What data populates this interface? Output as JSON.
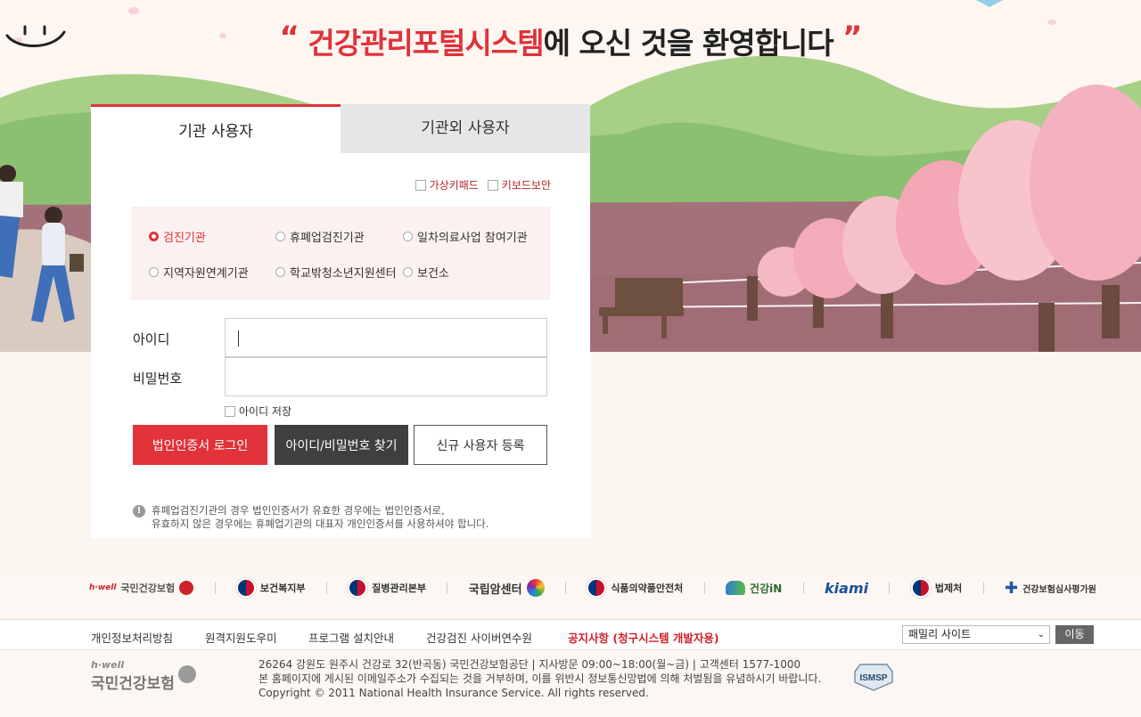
{
  "welcome": {
    "open_quote": "“",
    "highlight": "건강관리포털시스템",
    "rest": "에 오신 것을 환영합니다",
    "close_quote": "”"
  },
  "tabs": [
    {
      "label": "기관 사용자",
      "active": true
    },
    {
      "label": "기관외 사용자",
      "active": false
    }
  ],
  "security": {
    "virtual_keypad": "가상키패드",
    "keyboard_security": "키보드보안"
  },
  "org_types": [
    {
      "label": "검진기관",
      "selected": true
    },
    {
      "label": "휴폐업검진기관",
      "selected": false
    },
    {
      "label": "일차의료사업 참여기관",
      "selected": false
    },
    {
      "label": "지역자원연계기관",
      "selected": false
    },
    {
      "label": "학교밖청소년지원센터",
      "selected": false
    },
    {
      "label": "보건소",
      "selected": false
    }
  ],
  "form": {
    "id_label": "아이디",
    "pw_label": "비밀번호",
    "save_id": "아이디 저장"
  },
  "buttons": {
    "cert_login": "법인인증서 로그인",
    "find_id_pw": "아이디/비밀번호 찾기",
    "register": "신규 사용자 등록"
  },
  "notice": {
    "line1": "휴폐업검진기관의 경우 법인인증서가 유효한 경우에는 법인인증서로,",
    "line2": "유효하지 않은 경우에는 휴폐업기관의 대표자 개인인증서를 사용하셔야 합니다."
  },
  "partners": {
    "nhis": "국민건강보험",
    "mohw": "보건복지부",
    "kdca": "질병관리본부",
    "ncc": "국립암센터",
    "mfds": "식품의약품안전처",
    "health_in": "건강iN",
    "kiami": "kiami",
    "moleg": "법제처",
    "hira": "건강보험심사평가원"
  },
  "footer_nav": {
    "privacy": "개인정보처리방침",
    "remote": "원격지원도우미",
    "install": "프로그램 설치안내",
    "cyber": "건강검진 사이버연수원",
    "notice": "공지사항 (청구시스템 개발자용)",
    "family_site": "패밀리 사이트",
    "go": "이동"
  },
  "footer": {
    "logo_small": "h·well",
    "logo_main": "국민건강보험",
    "address": "26264 강원도 원주시 건강로 32(반곡동) 국민건강보험공단 | 지사방문 09:00~18:00(월~금) | 고객센터 1577-1000",
    "email_notice": "본 홈페이지에 게시된 이메일주소가 수집되는 것을 거부하며, 이를 위반시 정보통신망법에 의해 처벌됨을 유념하시기 바랍니다.",
    "copyright": "Copyright © 2011 National Health Insurance Service. All rights reserved.",
    "isms": "ISMSP"
  },
  "colors": {
    "accent": "#e0323a",
    "dark_button": "#3f3f3f",
    "hill": "#8cc071",
    "ground": "#a3717a",
    "blossom": "#f4b8c4"
  }
}
